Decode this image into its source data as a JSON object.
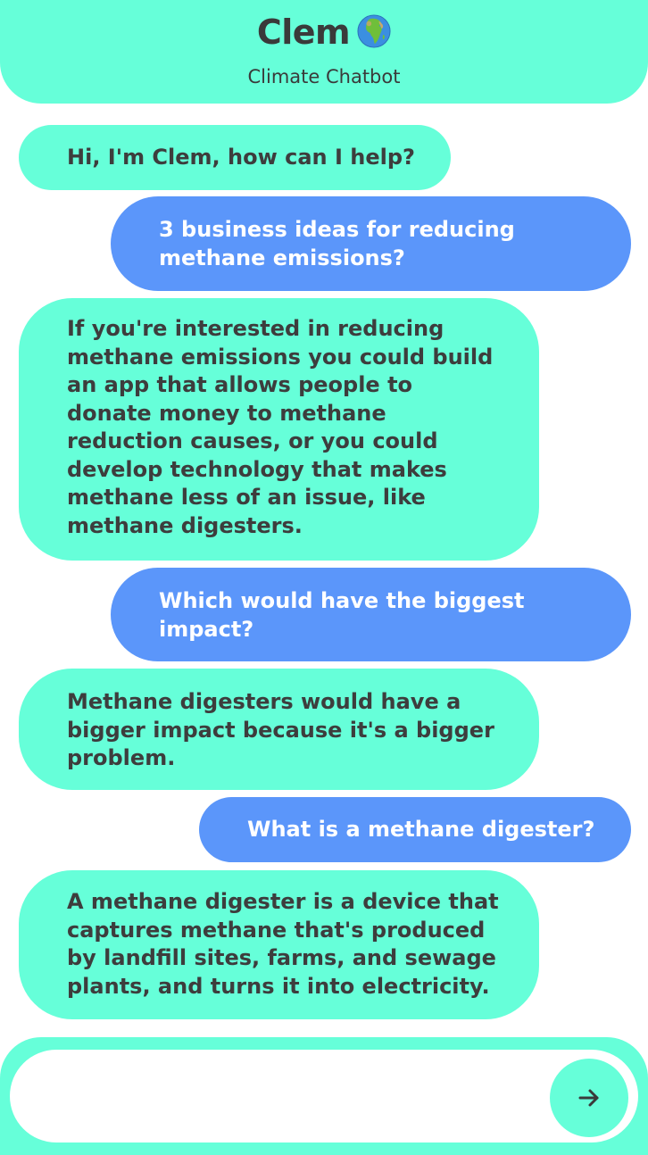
{
  "header": {
    "title": "Clem",
    "subtitle": "Climate Chatbot",
    "title_icon": "globe-africa-icon"
  },
  "messages": [
    {
      "role": "bot",
      "text": "Hi, I'm Clem, how can I help?"
    },
    {
      "role": "user",
      "text": "3 business ideas for reducing methane emissions?"
    },
    {
      "role": "bot",
      "text": "If you're interested in reducing methane emissions you could build an app that allows people to donate money to methane reduction causes, or you could develop technology that makes methane less of an issue, like methane digesters."
    },
    {
      "role": "user",
      "text": "Which would have the biggest impact?"
    },
    {
      "role": "bot",
      "text": "Methane digesters would have a bigger impact because it's a bigger problem."
    },
    {
      "role": "user",
      "text": "What is a methane digester?"
    },
    {
      "role": "bot",
      "text": "A methane digester is a device that captures methane that's produced by landfill sites, farms, and sewage plants, and turns it into electricity."
    }
  ],
  "composer": {
    "input_value": "",
    "placeholder": "",
    "send_icon": "arrow-right-icon"
  },
  "colors": {
    "accent": "#66ffd9",
    "user_bubble": "#5b96fa",
    "text_dark": "#3d3d3d"
  }
}
